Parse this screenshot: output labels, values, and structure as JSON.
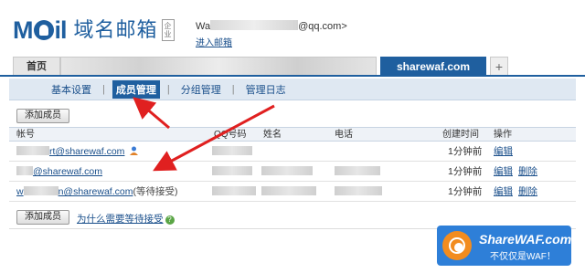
{
  "header": {
    "logo_text_a": "M",
    "logo_text_b": "il",
    "product_name": "域名邮箱",
    "badge": "企业",
    "user_email_prefix": "Wa",
    "user_email_suffix": "@qq.com>",
    "enter_mail_link": "进入邮箱"
  },
  "tabs": {
    "home": "首页",
    "active_domain": "sharewaf.com",
    "add": "+"
  },
  "subnav": {
    "items": [
      "基本设置",
      "成员管理",
      "分组管理",
      "管理日志"
    ],
    "active_index": 1
  },
  "toolbar": {
    "add_member_label": "添加成员"
  },
  "table": {
    "columns": [
      "帐号",
      "QQ号码",
      "姓名",
      "电话",
      "创建时间",
      "操作"
    ],
    "rows": [
      {
        "account_prefix": "",
        "account_suffix": "rt@sharewaf.com",
        "created": "1分钟前",
        "ops": [
          "编辑"
        ],
        "status": ""
      },
      {
        "account_prefix": "",
        "account_suffix": "@sharewaf.com",
        "created": "1分钟前",
        "ops": [
          "编辑",
          "删除"
        ],
        "status": ""
      },
      {
        "account_prefix": "w",
        "account_suffix": "n@sharewaf.com",
        "created": "1分钟前",
        "ops": [
          "编辑",
          "删除"
        ],
        "status": "(等待接受)"
      }
    ]
  },
  "footer": {
    "add_member_label": "添加成员",
    "why_wait_link": "为什么需要等待接受",
    "help_icon": "?"
  },
  "watermark": {
    "line1": "ShareWAF.com",
    "line2": "不仅仅是WAF！"
  },
  "colors": {
    "brand": "#1f5f9f",
    "arrow": "#e02020",
    "watermark_bg": "#2e7fd8",
    "watermark_circle": "#f28c1f"
  }
}
